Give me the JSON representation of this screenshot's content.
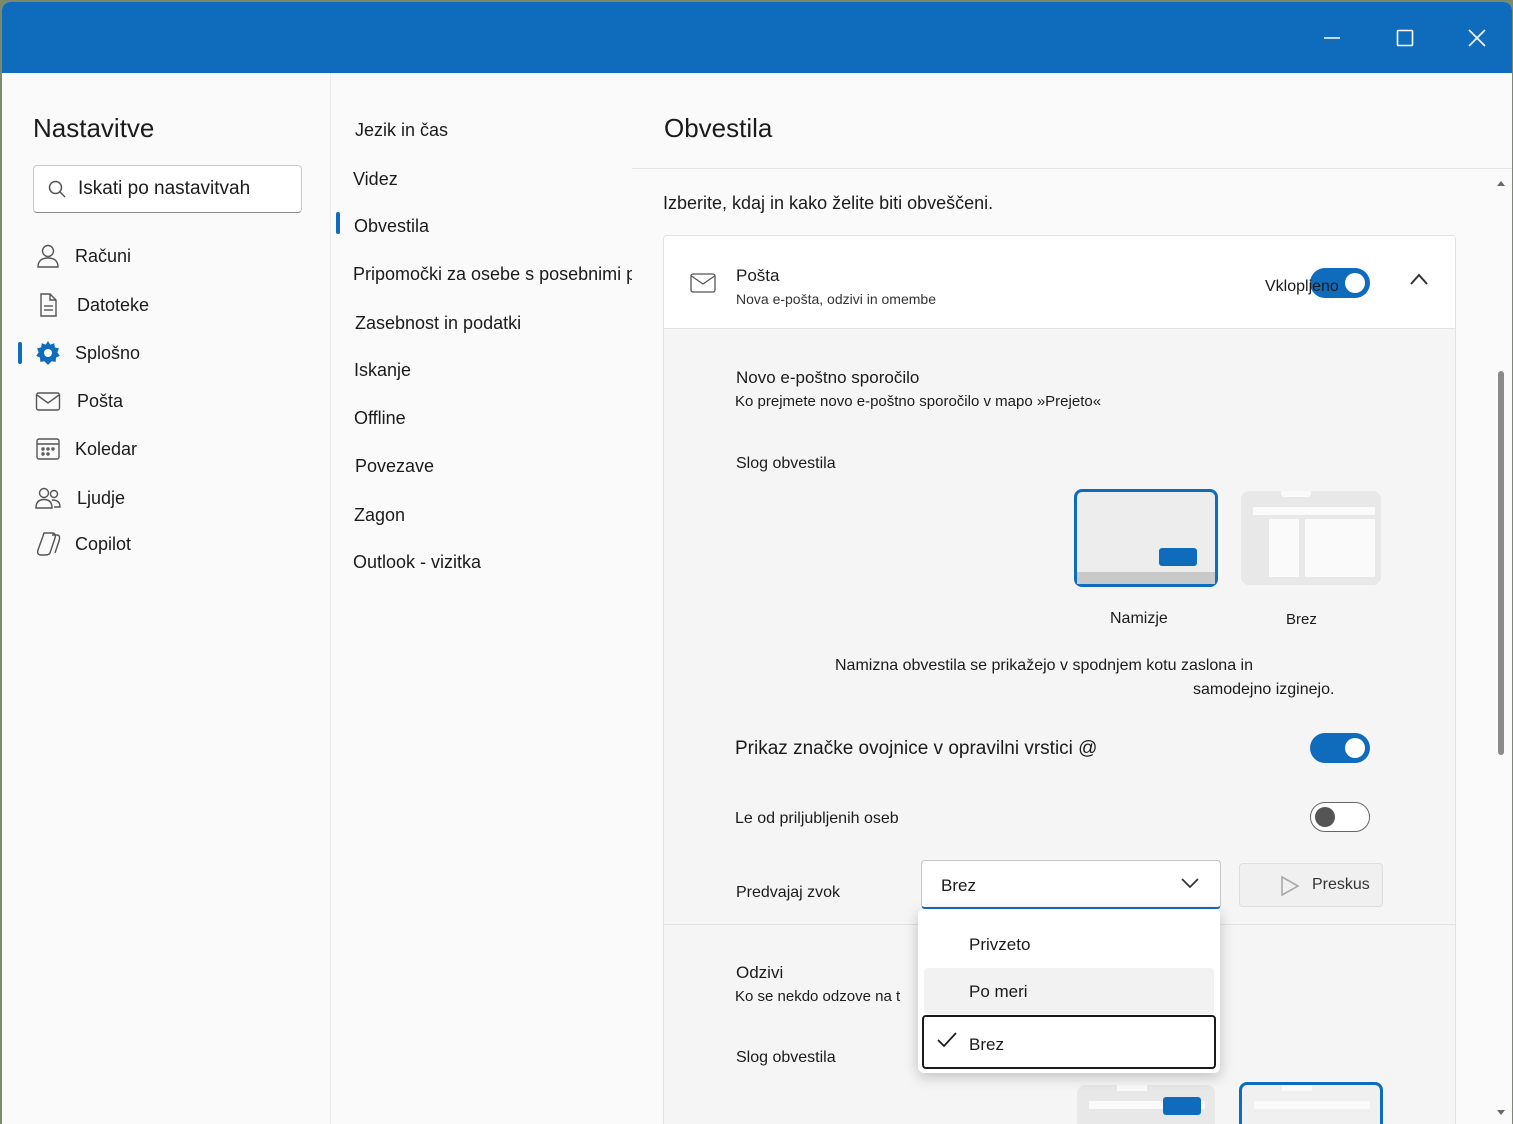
{
  "window": {
    "controls": [
      "minimize",
      "maximize",
      "close"
    ]
  },
  "left": {
    "title": "Nastavitve",
    "search_placeholder": "Iskati po nastavitvah",
    "items": [
      {
        "label": "Računi",
        "icon": "person-icon"
      },
      {
        "label": "Datoteke",
        "icon": "document-icon"
      },
      {
        "label": "Splošno",
        "icon": "gear-icon",
        "selected": true
      },
      {
        "label": "Pošta",
        "icon": "mail-icon"
      },
      {
        "label": "Koledar",
        "icon": "calendar-icon"
      },
      {
        "label": "Ljudje",
        "icon": "people-icon"
      },
      {
        "label": "Copilot",
        "icon": "copilot-icon"
      }
    ]
  },
  "middle": {
    "items": [
      {
        "label": "Jezik in čas"
      },
      {
        "label": "Videz"
      },
      {
        "label": "Obvestila",
        "selected": true
      },
      {
        "label": "Pripomočki za osebe s posebnimi potrebami"
      },
      {
        "label": "Zasebnost in podatki"
      },
      {
        "label": "Iskanje"
      },
      {
        "label": "Offline"
      },
      {
        "label": "Povezave"
      },
      {
        "label": "Zagon"
      },
      {
        "label": "Outlook - vizitka"
      }
    ]
  },
  "main": {
    "title": "Obvestila",
    "intro": "Izberite, kdaj in kako želite biti obveščeni.",
    "mail_card": {
      "title": "Pošta",
      "subtitle": "Nova e-pošta, odzivi in omembe",
      "toggle_label": "Vklopljeno",
      "toggle_on": true,
      "new_mail": {
        "title": "Novo e-poštno sporočilo",
        "subtitle": "Ko prejmete novo e-poštno sporočilo v mapo »Prejeto«",
        "style_label": "Slog obvestila",
        "styles": [
          "Namizje",
          "Brez"
        ],
        "selected_style": "Namizje",
        "desc_line1": "Namizna obvestila se prikažejo v spodnjem kotu zaslona in",
        "desc_line2": "samodejno izginejo.",
        "badge_label": "Prikaz značke ovojnice v opravilni vrstici @",
        "badge_on": true,
        "favorites_label": "Le od priljubljenih oseb",
        "favorites_on": false,
        "sound_label": "Predvajaj zvok",
        "sound_value": "Brez",
        "preview_label": "Preskus"
      },
      "replies": {
        "title": "Odzivi",
        "subtitle": "Ko se nekdo odzove na t",
        "style_label": "Slog obvestila"
      }
    },
    "sound_menu": {
      "options": [
        "Privzeto",
        "Po meri",
        "Brez"
      ],
      "selected": "Brez",
      "hovered": "Po meri"
    }
  },
  "colors": {
    "accent": "#0f6cbd",
    "titlebar": "#0f6cbd"
  }
}
